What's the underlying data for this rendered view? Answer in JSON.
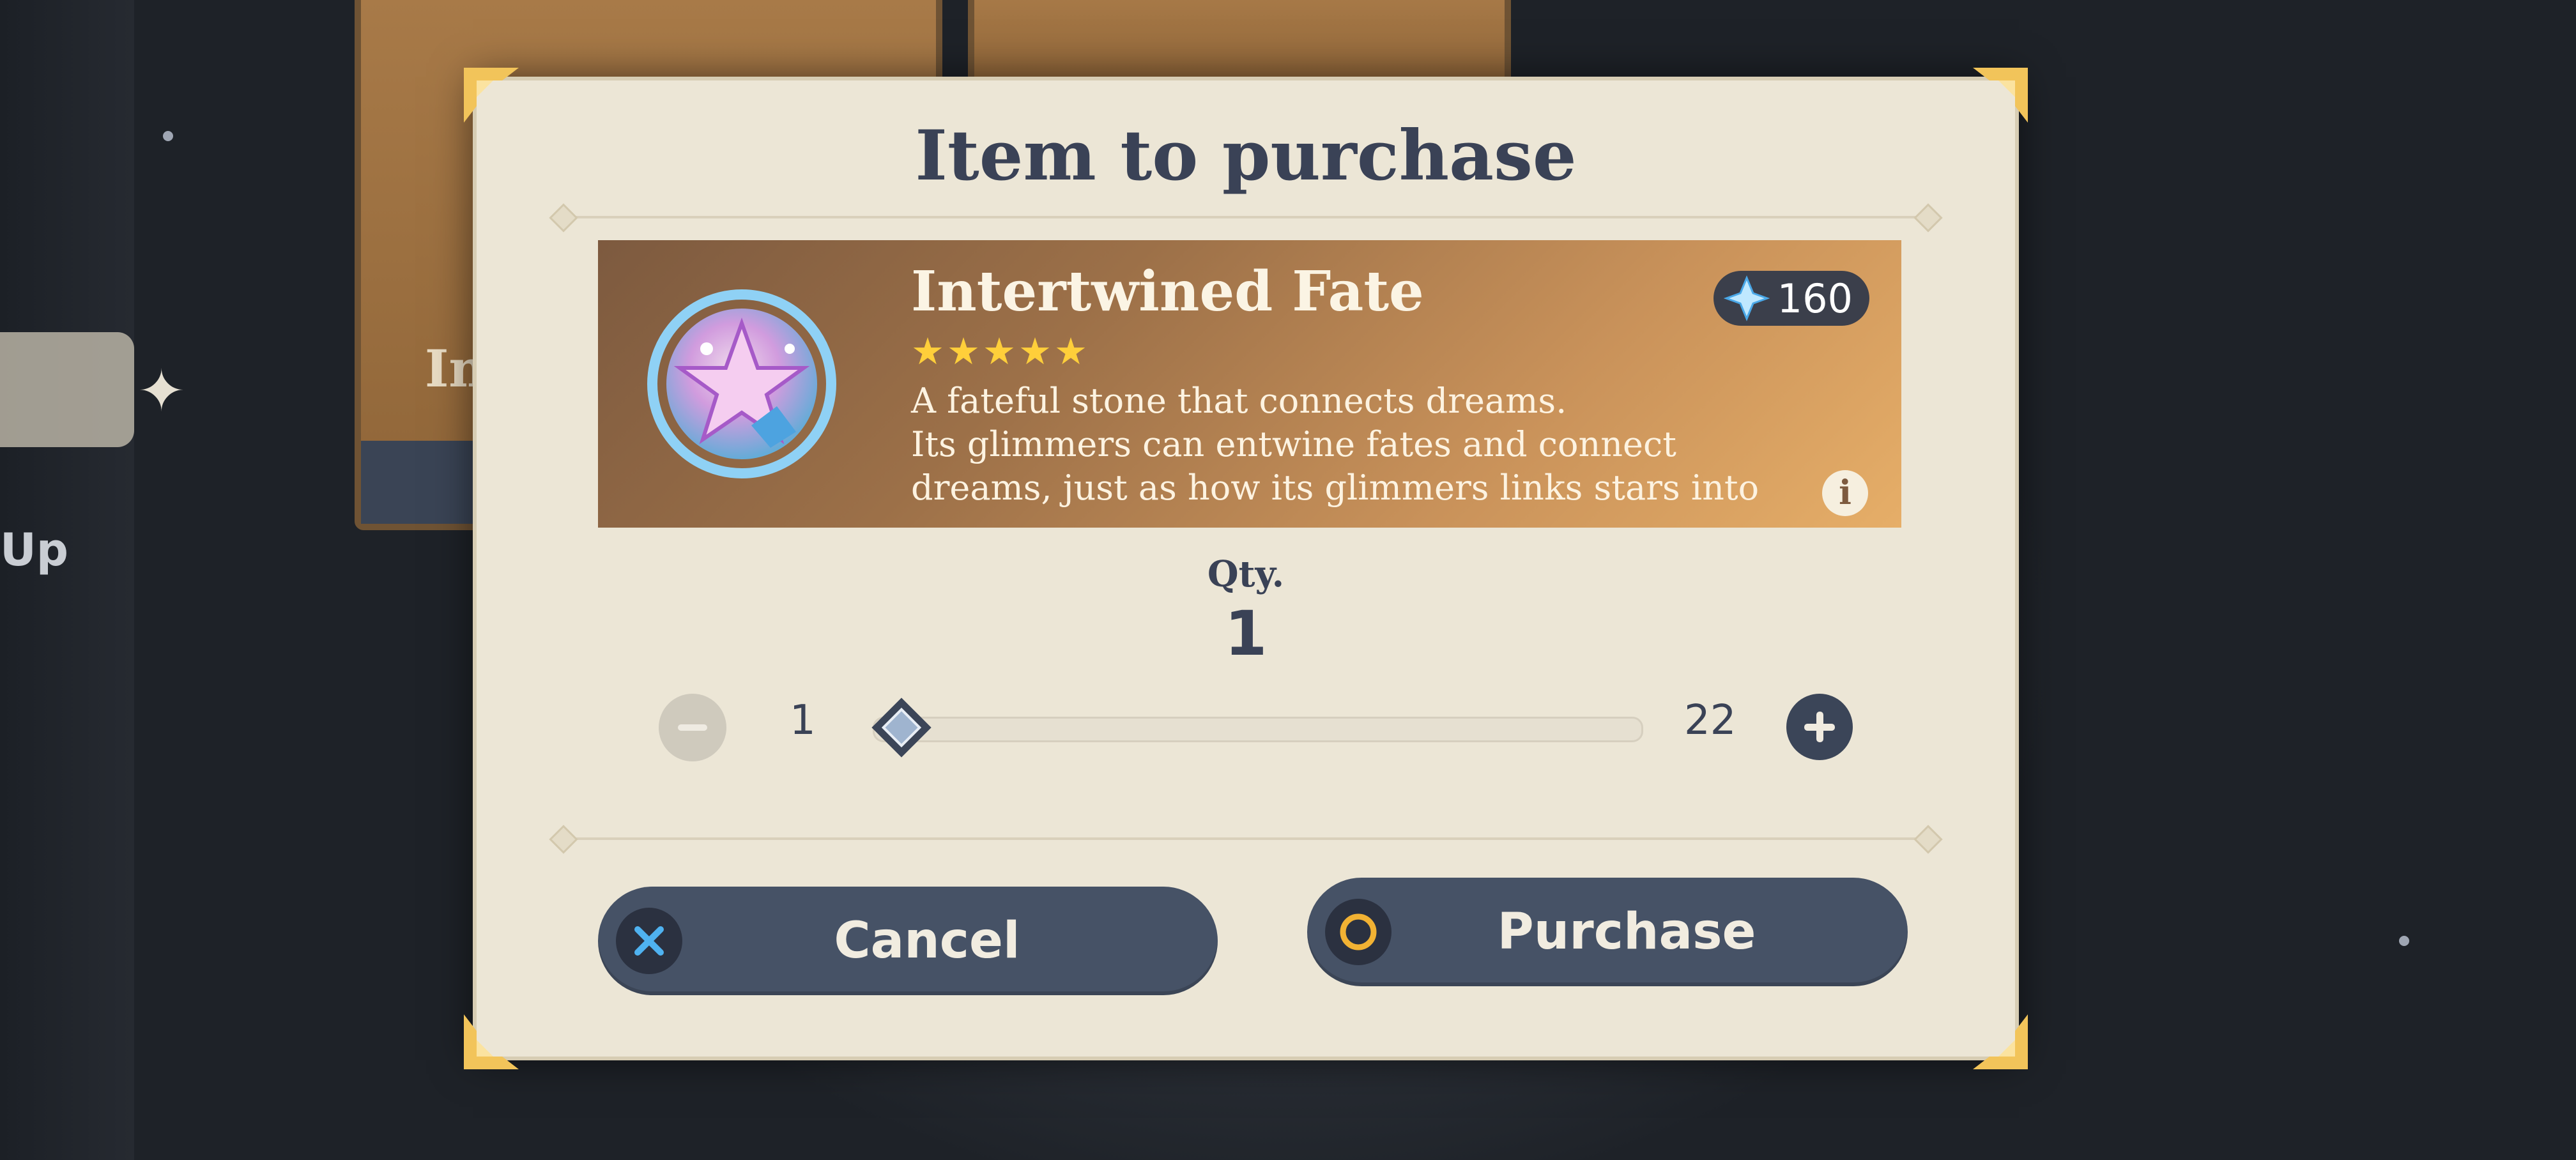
{
  "background": {
    "card_fragment_text": "In",
    "side_label": "Up"
  },
  "dialog": {
    "title": "Item to purchase",
    "item": {
      "name": "Intertwined Fate",
      "rarity_stars": "★★★★★",
      "rarity": 5,
      "description_lines": [
        "A fateful stone that connects dreams.",
        "Its glimmers can entwine fates and connect",
        "dreams, just as how its glimmers links stars into"
      ],
      "price": "160",
      "currency_icon": "primogem-icon",
      "info_icon": "info-icon"
    },
    "quantity": {
      "label": "Qty.",
      "value": "1",
      "min": "1",
      "max": "22",
      "slider_fraction": 0.0
    },
    "buttons": {
      "cancel_label": "Cancel",
      "cancel_icon": "x-icon",
      "purchase_label": "Purchase",
      "purchase_icon": "circle-icon"
    }
  },
  "colors": {
    "dialog_bg": "#ece6d6",
    "text_dark": "#3a4256",
    "button_bg": "#465266",
    "star": "#ffcf3a",
    "accent_gold": "#f2c45a"
  }
}
